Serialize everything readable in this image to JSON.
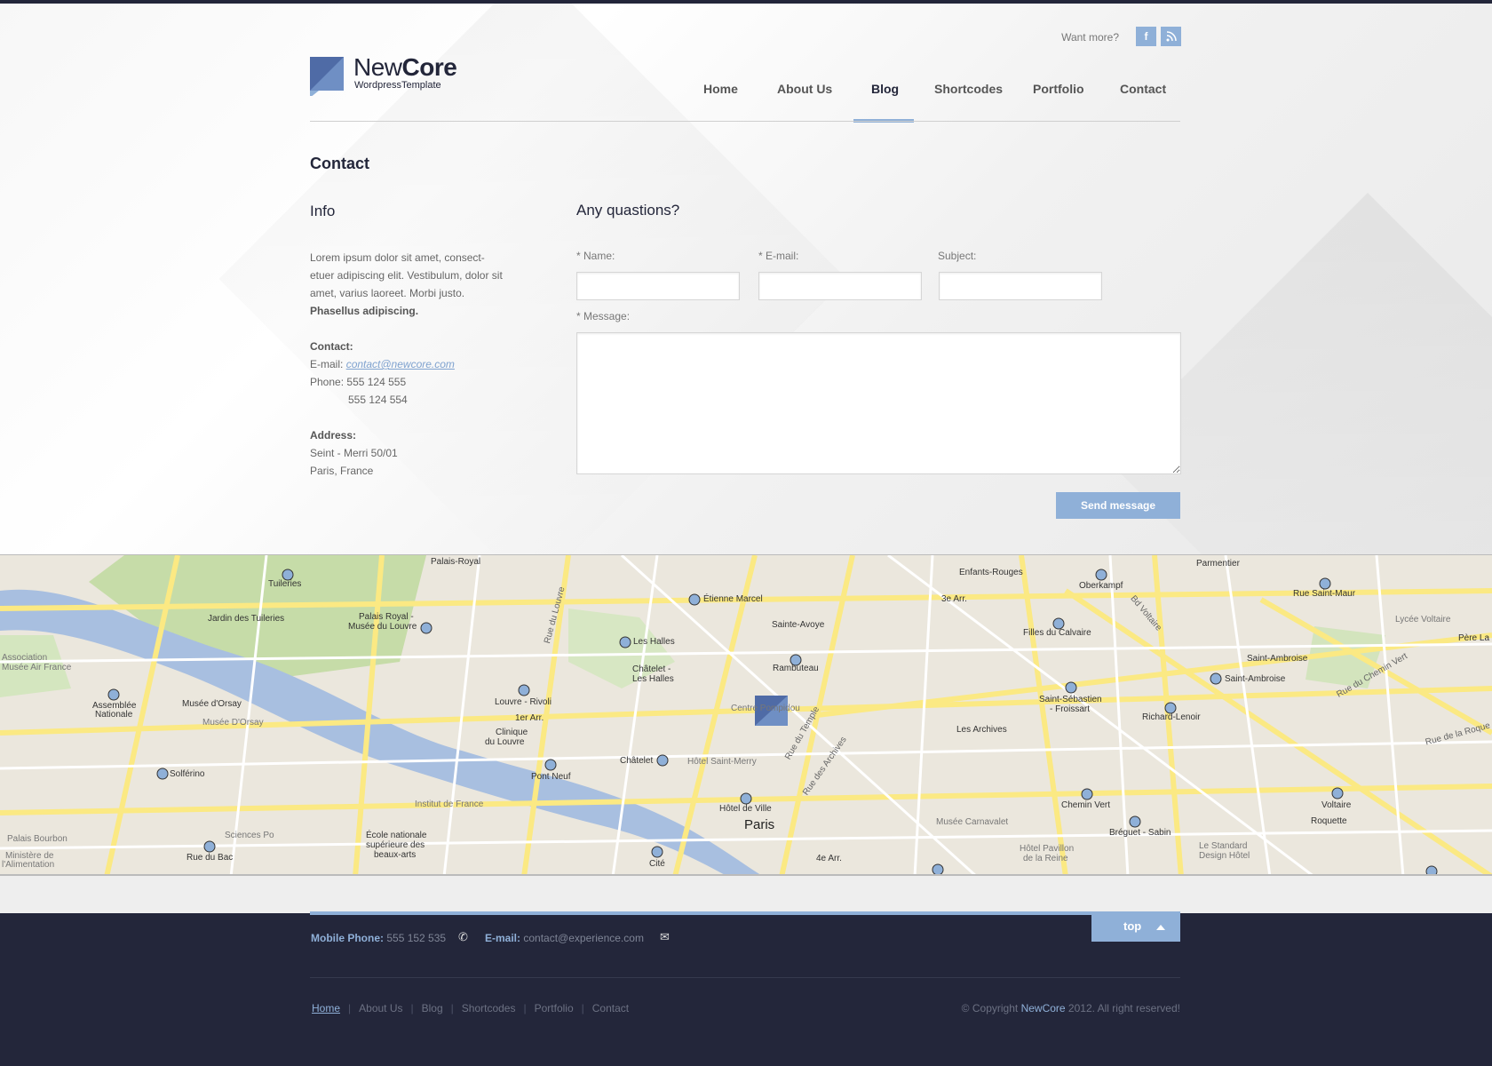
{
  "header": {
    "want_more": "Want more?",
    "social": {
      "facebook": "f",
      "rss": ")"
    },
    "logo": {
      "name_light": "New",
      "name_bold": "Core",
      "subtitle": "WordpressTemplate"
    },
    "nav": [
      {
        "label": "Home",
        "active": false
      },
      {
        "label": "About Us",
        "active": false
      },
      {
        "label": "Blog",
        "active": true
      },
      {
        "label": "Shortcodes",
        "active": false
      },
      {
        "label": "Portfolio",
        "active": false
      },
      {
        "label": "Contact",
        "active": false
      }
    ]
  },
  "page": {
    "title": "Contact"
  },
  "info": {
    "title": "Info",
    "body": "Lorem ipsum dolor sit amet, consect-etuer adipiscing elit. Vestibulum, dolor sit amet, varius laoreet. Morbi justo.",
    "body_bold": "Phasellus adipiscing.",
    "contact_label": "Contact:",
    "email_label": "E-mail:",
    "email": "contact@newcore.com",
    "phone_label": "Phone:",
    "phone1": "555 124 555",
    "phone2": "555 124 554",
    "address_label": "Address:",
    "address1": "Seint - Merri 50/01",
    "address2": "Paris, France"
  },
  "form": {
    "title": "Any quastions?",
    "name_label": "* Name:",
    "email_label": "* E-mail:",
    "subject_label": "Subject:",
    "message_label": "* Message:",
    "name_value": "",
    "email_value": "",
    "subject_value": "",
    "message_value": "",
    "send_label": "Send message"
  },
  "map": {
    "labels": {
      "palais_royal": "Palais-Royal",
      "tuileries": "Tuileries",
      "jardin": "Jardin des Tuileries",
      "palais_louvre": "Palais Royal -",
      "palais_louvre2": "Musée du Louvre",
      "etienne": "Étienne Marcel",
      "sainte_avoye": "Sainte-Avoye",
      "les_halles": "Les Halles",
      "chatelet_halles": "Châtelet -",
      "chatelet_halles2": "Les Halles",
      "rambuteau": "Rambuteau",
      "louvre_rivoli": "Louvre - Rivoli",
      "arr1": "1er Arr.",
      "clinique": "Clinique",
      "clinique2": "du Louvre",
      "assemblee": "Assemblée",
      "assemblee2": "Nationale",
      "musee_orsay_st": "Musée d'Orsay",
      "musee_orsay": "Musée D'Orsay",
      "solferino": "Solférino",
      "chatelet": "Châtelet",
      "hotel_saint_merry": "Hôtel Saint-Merry",
      "pont_neuf": "Pont Neuf",
      "hotel_de_ville": "Hôtel de Ville",
      "paris": "Paris",
      "institut": "Institut de France",
      "ecole": "École nationale",
      "ecole2": "supérieure des",
      "ecole3": "beaux-arts",
      "sciences_po": "Sciences Po",
      "rue_du_bac": "Rue du Bac",
      "palais_bourbon": "Palais Bourbon",
      "ministere": "Ministère de",
      "ministere2": "l'Alimentation",
      "cite": "Cité",
      "arr4": "4e Arr.",
      "enfants_rouges": "Enfants-Rouges",
      "oberkampf": "Oberkampf",
      "arr3": "3e Arr.",
      "filles_calvaire": "Filles du Calvaire",
      "saint_sebastien": "Saint-Sébastien",
      "saint_sebastien2": "- Froissart",
      "les_archives": "Les Archives",
      "chemin_vert": "Chemin Vert",
      "breguet": "Bréguet - Sabin",
      "musee_carnavalet": "Musée Carnavalet",
      "hotel_pavillon": "Hôtel Pavillon",
      "hotel_pavillon2": "de la Reine",
      "parmentier": "Parmentier",
      "rue_saint_maur": "Rue Saint-Maur",
      "lycee_voltaire": "Lycée Voltaire",
      "saint_ambroise": "Saint-Ambroise",
      "saint_ambroise_st": "Saint-Ambroise",
      "richard_lenoir": "Richard-Lenoir",
      "voltaire": "Voltaire",
      "roquette": "Roquette",
      "bd_voltaire": "Bd Voltaire",
      "rue_chemin_vert": "Rue du Chemin Vert",
      "rue_temple": "Rue du Temple",
      "rue_archives": "Rue des Archives",
      "rue_louvre": "Rue du Louvre",
      "centre": "Centre Pompidou",
      "association": "Association",
      "musee_air": "Musée Air France",
      "le_standard": "Le Standard",
      "design_hotel": "Design Hôtel",
      "pere_la": "Père La",
      "rue_roquette": "Rue de la Roque"
    }
  },
  "footer": {
    "mobile_label": "Mobile Phone:",
    "mobile": "555 152 535",
    "email_label": "E-mail:",
    "email": "contact@experience.com",
    "top_label": "top",
    "links": [
      "Home",
      "About Us",
      "Blog",
      "Shortcodes",
      "Portfolio",
      "Contact"
    ],
    "copyright_prefix": "© Copyright",
    "brand": "NewCore",
    "copyright_suffix": "2012. All right reserved!"
  },
  "colors": {
    "accent": "#8fb0d8",
    "dark": "#23263a"
  }
}
